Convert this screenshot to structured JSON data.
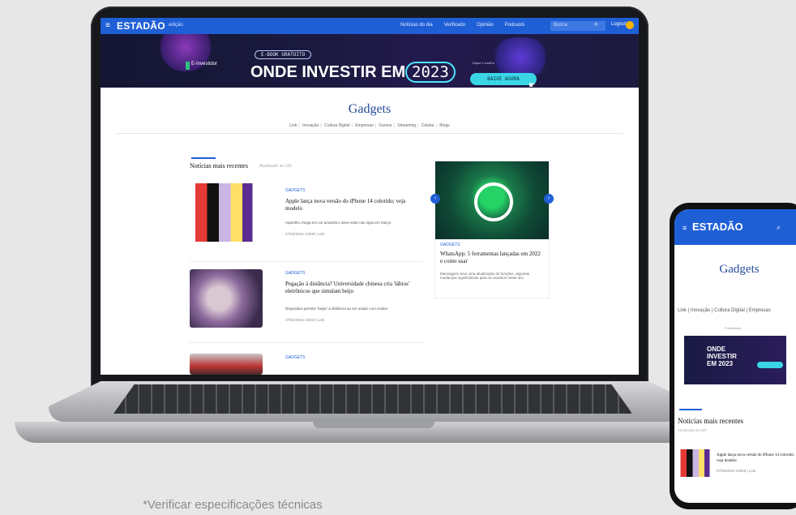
{
  "navbar": {
    "logo": "ESTADÃO",
    "edition": "edição",
    "links": [
      "Notícias do dia",
      "Verificado",
      "Opinião",
      "Podcasts"
    ],
    "search_placeholder": "Busca",
    "login": "Logout"
  },
  "banner": {
    "brand": "E-Investidor",
    "pill": "E-BOOK GRATUITO",
    "headline": "ONDE INVESTIR EM",
    "year": "2023",
    "cta_small": "Clique e confira",
    "cta": "BAIXE AGORA"
  },
  "section": {
    "title": "Gadgets",
    "subnav": [
      "Link",
      "Inovação",
      "Cultura Digital",
      "Empresas",
      "Games",
      "Streaming",
      "Celular",
      "Blogs"
    ]
  },
  "latest": {
    "title": "Notícias mais recentes",
    "subtitle": "Atualizado às 10h"
  },
  "articles": [
    {
      "tag": "GADGETS",
      "title": "Apple lança nova versão do iPhone 14 colorido; veja modelo",
      "desc": "Aparelho chega em cor amarela e deve estar nas lojas em março",
      "meta": "07/03/2023 13h08 | Link"
    },
    {
      "tag": "GADGETS",
      "title": "Pegação à distância? Universidade chinesa cria 'lábios' eletrônicos que simulam beijo",
      "desc": "Dispositivo permite 'beijar' à distância ao ser usado com celular",
      "meta": "27/02/2023 14h40 | Link"
    },
    {
      "tag": "GADGETS",
      "title": "",
      "desc": "",
      "meta": ""
    }
  ],
  "side_article": {
    "tag": "GADGETS",
    "title": "WhatsApp: 5 ferramentas lançadas em 2022 e como usar",
    "desc": "Mensageiro teve uma atualização de funções, algumas mudanças significativas para os usuários neste ano"
  },
  "phone": {
    "logo": "ESTADÃO",
    "title": "Gadgets",
    "subnav": "Link | Inovação | Cultura Digital | Empresas",
    "ad_label": "Publicidade",
    "ad_text": "ONDE INVESTIR EM 2023",
    "latest": "Notícias mais recentes",
    "latest_sub": "Atualizado às 10h",
    "card_title": "Apple lança nova versão do iPhone 14 colorido; veja modelo",
    "card_meta": "07/03/2023 13h08 | Link"
  },
  "footnote": "*Verificar especificações técnicas"
}
